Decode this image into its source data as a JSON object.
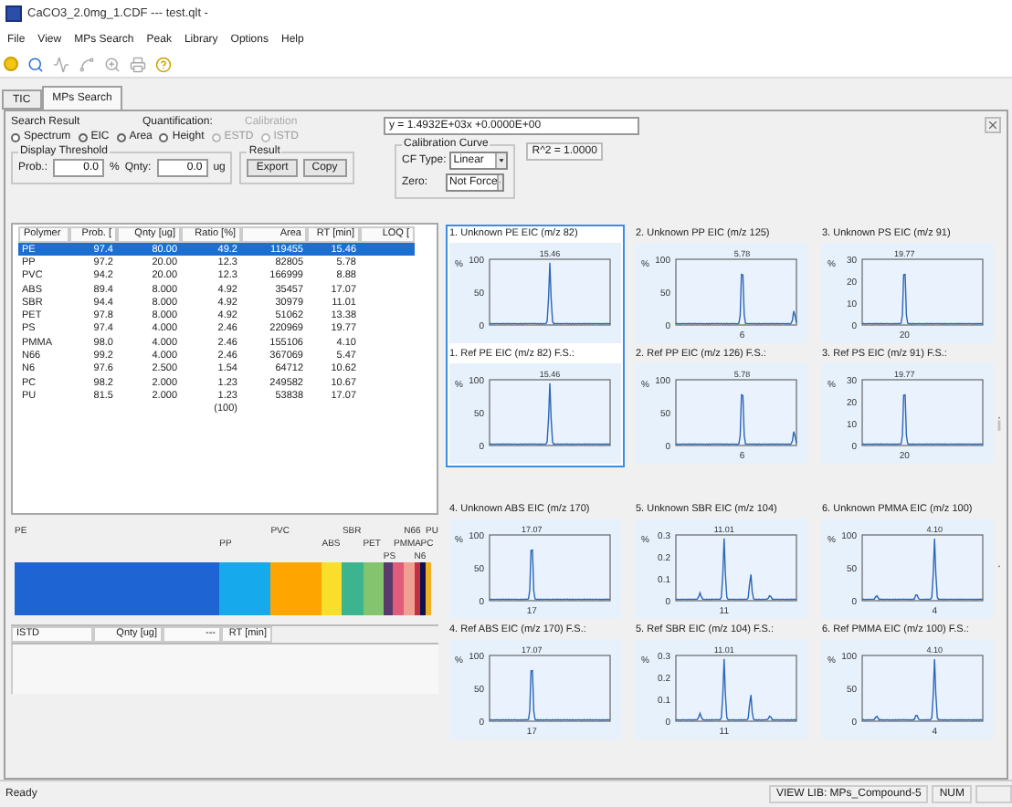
{
  "window": {
    "title": "CaCO3_2.0mg_1.CDF --- test.qlt -"
  },
  "menu": [
    "File",
    "View",
    "MPs Search",
    "Peak",
    "Library",
    "Options",
    "Help"
  ],
  "toolbar": [
    {
      "kind": "disc",
      "disabled": false
    },
    {
      "kind": "search",
      "disabled": false
    },
    {
      "kind": "peak",
      "disabled": true
    },
    {
      "kind": "integrate",
      "disabled": true
    },
    {
      "kind": "zoom",
      "disabled": true
    },
    {
      "kind": "print",
      "disabled": true
    },
    {
      "kind": "help",
      "disabled": false
    }
  ],
  "tabs": [
    {
      "label": "TIC",
      "selected": false
    },
    {
      "label": "MPs Search",
      "selected": true
    }
  ],
  "search_result": {
    "label": "Search Result",
    "options": [
      {
        "label": "Spectrum",
        "selected": false
      },
      {
        "label": "EIC",
        "selected": true
      }
    ]
  },
  "quantification": {
    "label": "Quantification:",
    "options": [
      {
        "label": "Area",
        "selected": true
      },
      {
        "label": "Height",
        "selected": false
      }
    ]
  },
  "calibration": {
    "label": "Calibration",
    "disabled": true,
    "options": [
      {
        "label": "ESTD",
        "selected": true
      },
      {
        "label": "ISTD",
        "selected": false
      }
    ]
  },
  "display_threshold": {
    "title": "Display Threshold",
    "fields": [
      {
        "label": "Prob.:",
        "value": "0.0",
        "unit": "%"
      },
      {
        "label": "Qnty:",
        "value": "0.0",
        "unit": "ug"
      }
    ]
  },
  "result": {
    "title": "Result",
    "buttons": [
      "Export",
      "Copy"
    ]
  },
  "equation": "y = 1.4932E+03x +0.0000E+00",
  "calibration_curve": {
    "title": "Calibration Curve",
    "selects": [
      {
        "label": "CF Type:",
        "value": "Linear"
      },
      {
        "label": "Zero:",
        "value": "Not Force"
      }
    ],
    "r_squared": "R^2 = 1.0000"
  },
  "results_table": {
    "columns": [
      "Polymer",
      "Prob. [",
      "Qnty [ug]",
      "Ratio [%]",
      "Area",
      "RT [min]",
      "LOQ ["
    ],
    "rows": [
      {
        "selected": true,
        "cells": [
          "PE",
          "97.4",
          "80.00",
          "49.2",
          "119455",
          "15.46"
        ]
      },
      {
        "selected": false,
        "cells": [
          "PP",
          "97.2",
          "20.00",
          "12.3",
          "82805",
          "5.78"
        ]
      },
      {
        "selected": false,
        "cells": [
          "PVC",
          "94.2",
          "20.00",
          "12.3",
          "166999",
          "8.88"
        ]
      },
      {
        "selected": false,
        "cells": [
          "ABS",
          "89.4",
          "8.000",
          "4.92",
          "35457",
          "17.07"
        ]
      },
      {
        "selected": false,
        "cells": [
          "SBR",
          "94.4",
          "8.000",
          "4.92",
          "30979",
          "11.01"
        ]
      },
      {
        "selected": false,
        "cells": [
          "PET",
          "97.8",
          "8.000",
          "4.92",
          "51062",
          "13.38"
        ]
      },
      {
        "selected": false,
        "cells": [
          "PS",
          "97.4",
          "4.000",
          "2.46",
          "220969",
          "19.77"
        ]
      },
      {
        "selected": false,
        "cells": [
          "PMMA",
          "98.0",
          "4.000",
          "2.46",
          "155106",
          "4.10"
        ]
      },
      {
        "selected": false,
        "cells": [
          "N66",
          "99.2",
          "4.000",
          "2.46",
          "367069",
          "5.47"
        ]
      },
      {
        "selected": false,
        "cells": [
          "N6",
          "97.6",
          "2.500",
          "1.54",
          "64712",
          "10.62"
        ]
      },
      {
        "selected": false,
        "cells": [
          "PC",
          "98.2",
          "2.000",
          "1.23",
          "249582",
          "10.67"
        ]
      },
      {
        "selected": false,
        "cells": [
          "PU",
          "81.5",
          "2.000",
          "1.23",
          "53838",
          "17.07"
        ]
      }
    ],
    "total_ratio": "(100)"
  },
  "composition_bar": {
    "segments": [
      {
        "label": "PE",
        "color": "#1e64d2"
      },
      {
        "label": "PP",
        "color": "#16a9ec"
      },
      {
        "label": "PVC",
        "color": "#ffa500"
      },
      {
        "label": "ABS",
        "color": "#f9de2a"
      },
      {
        "label": "SBR",
        "color": "#3cb58f"
      },
      {
        "label": "PET",
        "color": "#84c46e"
      },
      {
        "label": "PS",
        "color": "#5a3a6a"
      },
      {
        "label": "PMMA",
        "color": "#e05c7a"
      },
      {
        "label": "N66",
        "color": "#f0a090"
      },
      {
        "label": "N6",
        "color": "#c03040"
      },
      {
        "label": "PC",
        "color": "#101050"
      },
      {
        "label": "PU",
        "color": "#f0b020"
      }
    ]
  },
  "istd_table": {
    "columns": [
      "ISTD",
      "Qnty [ug]",
      "---",
      "RT [min]"
    ]
  },
  "plot_pairs": [
    {
      "selected": true,
      "unknown": {
        "title": "1. Unknown PE EIC (m/z 82)",
        "y_unit": "%",
        "yticks": [
          "100",
          "50",
          "0"
        ],
        "peak_label": "15.46"
      },
      "reference": {
        "title": "1. Ref PE EIC (m/z 82) F.S.:",
        "y_unit": "%",
        "yticks": [
          "100",
          "50",
          "0"
        ],
        "peak_label": "15.46"
      }
    },
    {
      "selected": false,
      "unknown": {
        "title": "2. Unknown PP EIC (m/z 125)",
        "y_unit": "%",
        "yticks": [
          "100",
          "50",
          "0"
        ],
        "peak_label": "5.78",
        "x_tick": "6"
      },
      "reference": {
        "title": "2. Ref PP EIC (m/z 126) F.S.:",
        "y_unit": "%",
        "yticks": [
          "100",
          "50",
          "0"
        ],
        "peak_label": "5.78",
        "x_tick": "6"
      }
    },
    {
      "selected": false,
      "unknown": {
        "title": "3. Unknown PS EIC (m/z 91)",
        "y_unit": "%",
        "yticks": [
          "30",
          "20",
          "10",
          "0"
        ],
        "peak_label": "19.77",
        "x_tick": "20"
      },
      "reference": {
        "title": "3. Ref PS EIC (m/z 91) F.S.:",
        "y_unit": "%",
        "yticks": [
          "30",
          "20",
          "10",
          "0"
        ],
        "peak_label": "19.77",
        "x_tick": "20"
      }
    },
    {
      "selected": false,
      "unknown": {
        "title": "4. Unknown ABS EIC (m/z 170)",
        "y_unit": "%",
        "yticks": [
          "100",
          "50",
          "0"
        ],
        "peak_label": "17.07",
        "x_tick": "17"
      },
      "reference": {
        "title": "4. Ref ABS EIC (m/z 170) F.S.:",
        "y_unit": "%",
        "yticks": [
          "100",
          "50",
          "0"
        ],
        "peak_label": "17.07",
        "x_tick": "17"
      }
    },
    {
      "selected": false,
      "unknown": {
        "title": "5. Unknown SBR EIC (m/z 104)",
        "y_unit": "%",
        "yticks": [
          "0.3",
          "0.2",
          "0.1",
          "0"
        ],
        "peak_label": "11.01",
        "x_tick": "11"
      },
      "reference": {
        "title": "5. Ref SBR EIC (m/z 104) F.S.:",
        "y_unit": "%",
        "yticks": [
          "0.3",
          "0.2",
          "0.1",
          "0"
        ],
        "peak_label": "11.01",
        "x_tick": "11"
      }
    },
    {
      "selected": false,
      "unknown": {
        "title": "6. Unknown PMMA EIC (m/z 100)",
        "y_unit": "%",
        "yticks": [
          "100",
          "50",
          "0"
        ],
        "peak_label": "4.10",
        "x_tick": "4"
      },
      "reference": {
        "title": "6. Ref PMMA EIC (m/z 100) F.S.:",
        "y_unit": "%",
        "yticks": [
          "100",
          "50",
          "0"
        ],
        "peak_label": "4.10",
        "x_tick": "4"
      }
    }
  ],
  "status_bar": {
    "message": "Ready",
    "library": "VIEW LIB: MPs_Compound-5",
    "num": "NUM"
  }
}
